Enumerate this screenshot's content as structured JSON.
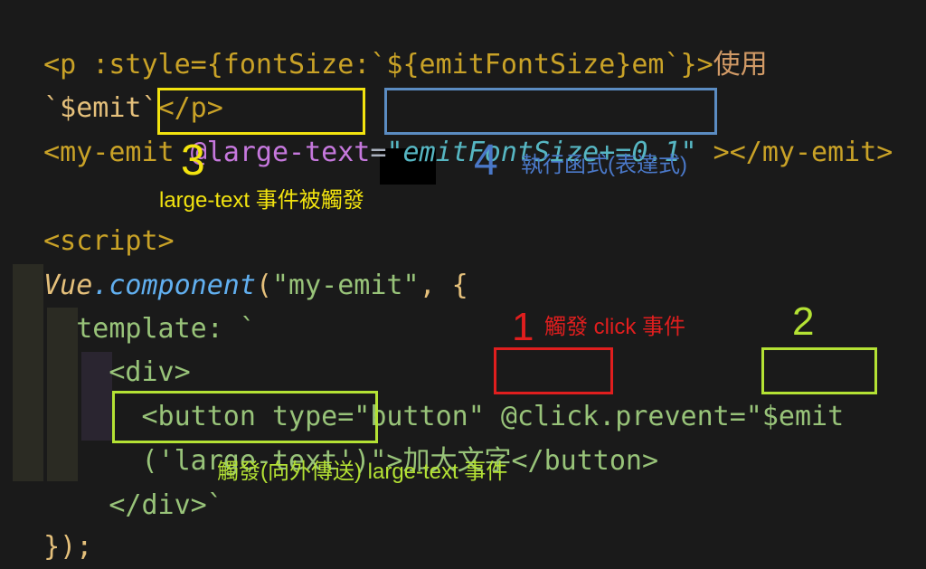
{
  "lines": {
    "l1a": "<p :style={fontSize:`${emitFontSize}em`}>",
    "l1b": "使用",
    "l2a": "`$emit`",
    "l2b": "</p>",
    "l3a": "<my-emit ",
    "l3b": "@large-text",
    "l3c": "=",
    "l3d": "\"emitFontSize+=0.1\"",
    "l3e": " ></my-emit>",
    "l4a": "<script>",
    "l5a": "Vue",
    "l5b": ".component",
    "l5c": "(",
    "l5d": "\"my-emit\"",
    "l5e": ", {",
    "l6a": "  template: `",
    "l7a": "    <div>",
    "l8a": "      <button type=\"button\" ",
    "l8b": "@click",
    "l8c": ".prevent=",
    "l8d": "\"$emit",
    "l9a": "      ('large-text')\"",
    "l9b": ">加大文字</button>",
    "l10a": "    </div>`",
    "l11a": "});"
  },
  "annotations": {
    "n1": "1",
    "t1": "觸發 click 事件",
    "n2": "2",
    "n3": "3",
    "t3": "large-text 事件被觸發",
    "n4": "4",
    "t4": "執行函式(表達式)",
    "t2": "觸發(向外傳送) large-text 事件"
  },
  "colors": {
    "box_yellow": "#f2e30f",
    "box_blue": "#5b8cc2",
    "box_red": "#e01e1e",
    "box_green": "#b4e234"
  }
}
